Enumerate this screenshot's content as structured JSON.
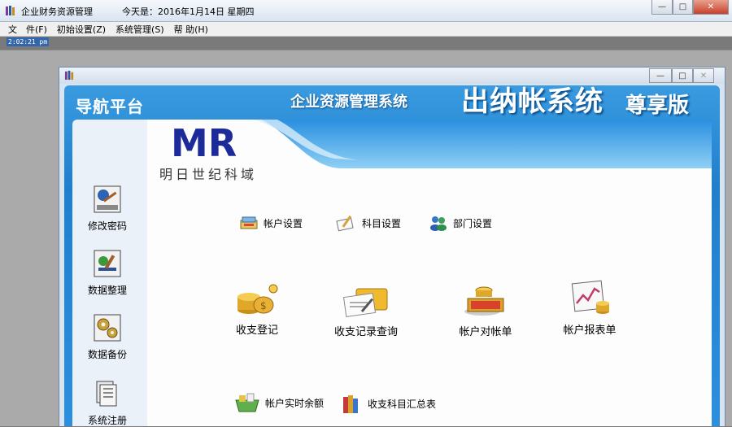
{
  "outer_window": {
    "title": "企业财务资源管理",
    "date_text": "今天是：2016年1月14日 星期四",
    "minimize": "—",
    "maximize": "□",
    "close": "✕"
  },
  "menu": [
    {
      "label": "文　件(F)"
    },
    {
      "label": "初始设置(Z)"
    },
    {
      "label": "系统管理(S)"
    },
    {
      "label": "帮 助(H)"
    }
  ],
  "clock": "2:02:21 pm",
  "inner_window": {
    "minimize": "—",
    "maximize": "□",
    "close": "✕"
  },
  "nav": {
    "title": "导航平台",
    "banner_sub": "企业资源管理系统",
    "banner_main": "出纳帐系统",
    "banner_version": "尊享版",
    "logo_letters": "MR",
    "logo_text": "明日世纪科域"
  },
  "sidebar": [
    {
      "label": "修改密码",
      "icon": "key-certificate-icon"
    },
    {
      "label": "数据整理",
      "icon": "data-tidy-icon"
    },
    {
      "label": "数据备份",
      "icon": "gears-backup-icon"
    },
    {
      "label": "系统注册",
      "icon": "documents-icon"
    }
  ],
  "small_items": [
    {
      "label": "帐户设置",
      "icon": "account-settings-icon"
    },
    {
      "label": "科目设置",
      "icon": "subject-settings-icon"
    },
    {
      "label": "部门设置",
      "icon": "department-settings-icon"
    }
  ],
  "big_items": [
    {
      "label": "收支登记",
      "icon": "coins-icon"
    },
    {
      "label": "收支记录查询",
      "icon": "records-query-icon"
    },
    {
      "label": "帐户对帐单",
      "icon": "statement-icon"
    },
    {
      "label": "帐户报表单",
      "icon": "report-chart-icon"
    }
  ],
  "bottom_items": [
    {
      "label": "帐户实时余额",
      "icon": "balance-basket-icon"
    },
    {
      "label": "收支科目汇总表",
      "icon": "summary-books-icon"
    }
  ],
  "colors": {
    "nav_blue": "#1f7fcf",
    "banner_light": "#8fd0f5",
    "logo_blue": "#1d2a99"
  }
}
